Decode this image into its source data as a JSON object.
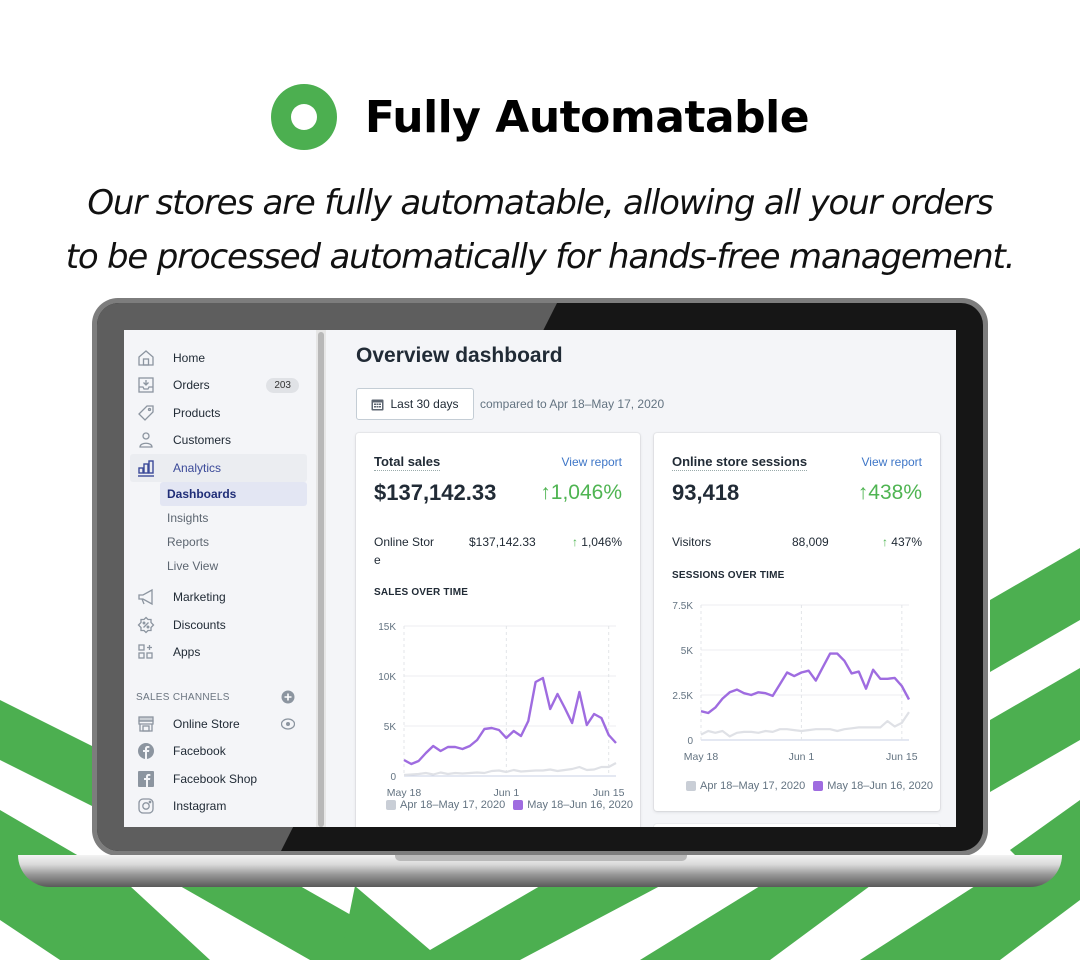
{
  "hero": {
    "title": "Fully Automatable",
    "subtitle_line1": "Our stores are fully automatable, allowing all your orders",
    "subtitle_line2": "to be processed automatically for hands-free management."
  },
  "colors": {
    "brand_green": "#4caf50",
    "series_current": "#9f6ce0",
    "series_previous": "#dfe1e6",
    "positive": "#4fb452",
    "link": "#3e76c7"
  },
  "sidebar": {
    "items": [
      {
        "label": "Home",
        "icon": "home-icon"
      },
      {
        "label": "Orders",
        "icon": "orders-icon",
        "badge": "203"
      },
      {
        "label": "Products",
        "icon": "tag-icon"
      },
      {
        "label": "Customers",
        "icon": "person-icon"
      },
      {
        "label": "Analytics",
        "icon": "bar-chart-icon",
        "active": true
      }
    ],
    "analytics_sub": [
      {
        "label": "Dashboards",
        "active": true
      },
      {
        "label": "Insights"
      },
      {
        "label": "Reports"
      },
      {
        "label": "Live View"
      }
    ],
    "items2": [
      {
        "label": "Marketing",
        "icon": "megaphone-icon"
      },
      {
        "label": "Discounts",
        "icon": "discount-icon"
      },
      {
        "label": "Apps",
        "icon": "apps-icon"
      }
    ],
    "sales_channels_title": "SALES CHANNELS",
    "channels": [
      {
        "label": "Online Store",
        "icon": "store-icon"
      },
      {
        "label": "Facebook",
        "icon": "facebook-icon"
      },
      {
        "label": "Facebook Shop",
        "icon": "facebook-shop-icon"
      },
      {
        "label": "Instagram",
        "icon": "instagram-icon"
      }
    ]
  },
  "main": {
    "page_title": "Overview dashboard",
    "date_button": "Last 30 days",
    "compared_text": "compared to Apr 18–May 17, 2020"
  },
  "cards": {
    "sales": {
      "title": "Total sales",
      "view_report": "View report",
      "value": "$137,142.33",
      "change": "↑1,046%",
      "row_label": "Online Stor e",
      "row_value": "$137,142.33",
      "row_change_arrow": "↑",
      "row_change": "1,046%",
      "section": "SALES OVER TIME"
    },
    "sessions": {
      "title": "Online store sessions",
      "view_report": "View report",
      "value": "93,418",
      "change": "↑438%",
      "row_label": "Visitors",
      "row_value": "88,009",
      "row_change_arrow": "↑",
      "row_change": "437%",
      "section": "SESSIONS OVER TIME"
    }
  },
  "chart_data": [
    {
      "type": "line",
      "title": "SALES OVER TIME",
      "x_ticks": [
        "May 18",
        "Jun 1",
        "Jun 15"
      ],
      "y_ticks": [
        "0",
        "5K",
        "10K",
        "15K"
      ],
      "ylim": [
        0,
        15000
      ],
      "grid": true,
      "legend_placement": "bottom",
      "series": [
        {
          "name": "Apr 18–May 17, 2020",
          "color": "#dfe1e6",
          "values": [
            100,
            150,
            200,
            300,
            150,
            350,
            200,
            300,
            250,
            300,
            350,
            300,
            500,
            550,
            400,
            600,
            450,
            500,
            550,
            550,
            650,
            500,
            600,
            700,
            900,
            600,
            650,
            900,
            900,
            1300
          ]
        },
        {
          "name": "May 18–Jun 16, 2020",
          "color": "#9f6ce0",
          "values": [
            1600,
            1200,
            1500,
            2300,
            3000,
            2500,
            2900,
            2900,
            2700,
            3000,
            3600,
            4700,
            4800,
            4600,
            3800,
            4500,
            4000,
            5500,
            9400,
            9800,
            6700,
            8200,
            6800,
            5300,
            8400,
            5100,
            6200,
            5800,
            4100,
            3300
          ]
        }
      ]
    },
    {
      "type": "line",
      "title": "SESSIONS OVER TIME",
      "x_ticks": [
        "May 18",
        "Jun 1",
        "Jun 15"
      ],
      "y_ticks": [
        "0",
        "2.5K",
        "5K",
        "7.5K"
      ],
      "ylim": [
        0,
        7500
      ],
      "grid": true,
      "legend_placement": "bottom",
      "series": [
        {
          "name": "Apr 18–May 17, 2020",
          "color": "#dfe1e6",
          "values": [
            300,
            500,
            400,
            500,
            200,
            400,
            450,
            450,
            400,
            500,
            450,
            600,
            600,
            550,
            500,
            550,
            600,
            600,
            600,
            500,
            600,
            650,
            700,
            700,
            700,
            700,
            1050,
            750,
            950,
            1550
          ]
        },
        {
          "name": "May 18–Jun 16, 2020",
          "color": "#9f6ce0",
          "values": [
            1600,
            1500,
            1800,
            2300,
            2650,
            2800,
            2600,
            2500,
            2650,
            2600,
            2450,
            3100,
            3750,
            3550,
            3750,
            3850,
            3300,
            4050,
            4800,
            4800,
            4400,
            3700,
            3800,
            2850,
            3900,
            3400,
            3400,
            3450,
            3000,
            2250
          ]
        }
      ]
    }
  ]
}
